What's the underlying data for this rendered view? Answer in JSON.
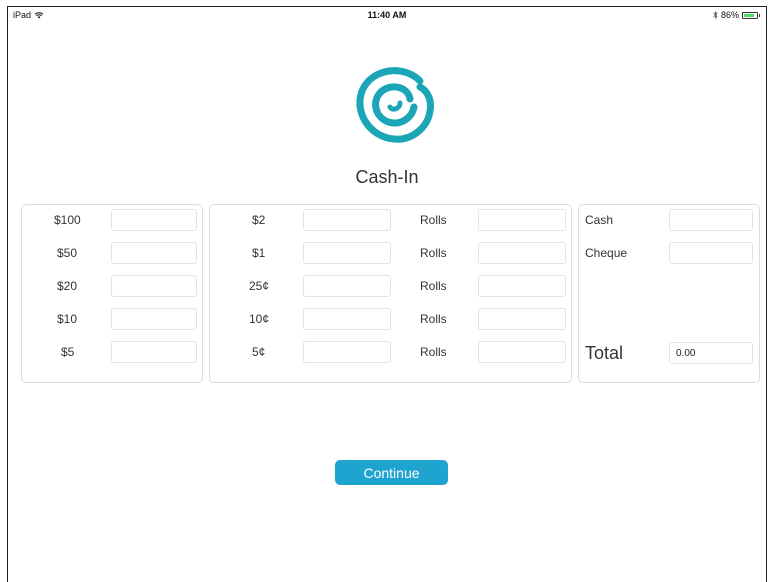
{
  "status_bar": {
    "device": "iPad",
    "time": "11:40 AM",
    "battery": "86%",
    "battery_level": 0.86
  },
  "title": "Cash-In",
  "bills": [
    {
      "label": "$100",
      "value": ""
    },
    {
      "label": "$50",
      "value": ""
    },
    {
      "label": "$20",
      "value": ""
    },
    {
      "label": "$10",
      "value": ""
    },
    {
      "label": "$5",
      "value": ""
    }
  ],
  "coins": [
    {
      "label": "$2",
      "value": "",
      "rolls_label": "Rolls",
      "rolls_value": ""
    },
    {
      "label": "$1",
      "value": "",
      "rolls_label": "Rolls",
      "rolls_value": ""
    },
    {
      "label": "25¢",
      "value": "",
      "rolls_label": "Rolls",
      "rolls_value": ""
    },
    {
      "label": "10¢",
      "value": "",
      "rolls_label": "Rolls",
      "rolls_value": ""
    },
    {
      "label": "5¢",
      "value": "",
      "rolls_label": "Rolls",
      "rolls_value": ""
    }
  ],
  "summary": {
    "cash_label": "Cash",
    "cash_value": "",
    "cheque_label": "Cheque",
    "cheque_value": "",
    "total_label": "Total",
    "total_value": "0.00"
  },
  "continue_label": "Continue",
  "colors": {
    "accent": "#1fa3cf",
    "logo": "#1aa6b7",
    "battery": "#4cd964"
  }
}
